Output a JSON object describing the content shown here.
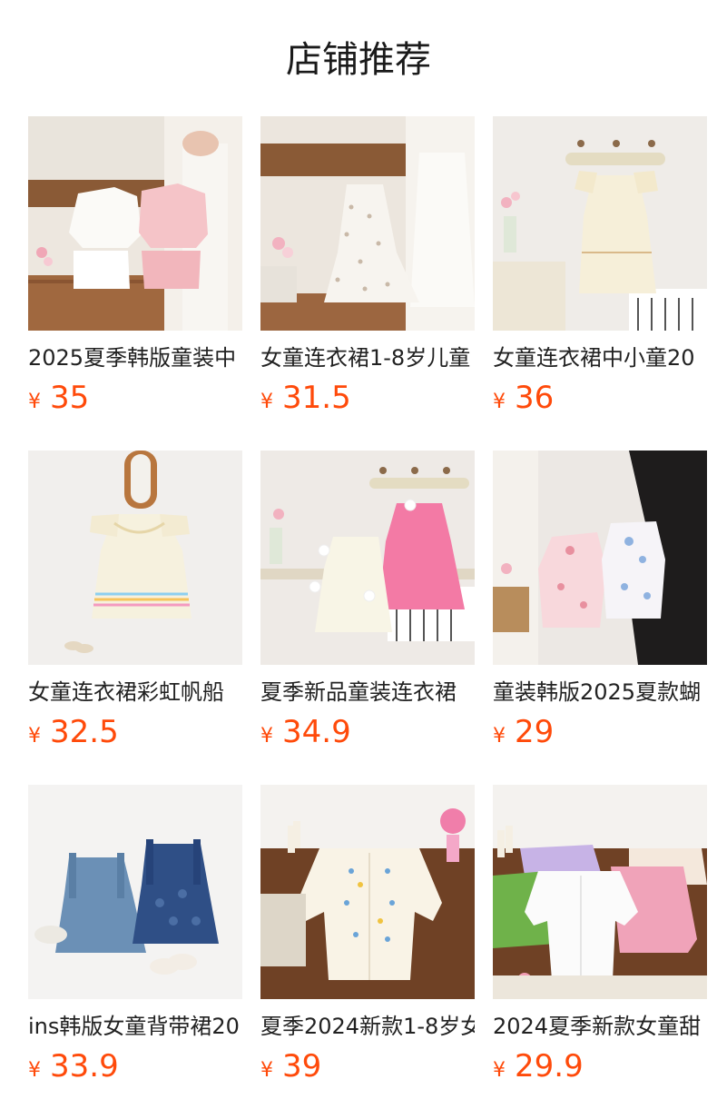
{
  "section_title": "店铺推荐",
  "currency_symbol": "¥",
  "accent_color": "#ff4a0a",
  "products": [
    {
      "name": "2025夏季韩版童装中",
      "price": "35",
      "image": "two-piece-outfits-image"
    },
    {
      "name": "女童连衣裙1-8岁儿童",
      "price": "31.5",
      "image": "floral-sundress-image"
    },
    {
      "name": "女童连衣裙中小童20",
      "price": "36",
      "image": "cream-dress-image"
    },
    {
      "name": "女童连衣裙彩虹帆船",
      "price": "32.5",
      "image": "rainbow-dress-image"
    },
    {
      "name": "夏季新品童装连衣裙",
      "price": "34.9",
      "image": "flower-dresses-image"
    },
    {
      "name": "童装韩版2025夏款蝴",
      "price": "29",
      "image": "bow-collar-dresses-image"
    },
    {
      "name": "ins韩版女童背带裙20",
      "price": "33.9",
      "image": "denim-overall-dresses-image"
    },
    {
      "name": "夏季2024新款1-8岁女",
      "price": "39",
      "image": "embroidered-cardigan-image"
    },
    {
      "name": "2024夏季新款女童甜",
      "price": "29.9",
      "image": "knit-cardigans-image"
    }
  ]
}
